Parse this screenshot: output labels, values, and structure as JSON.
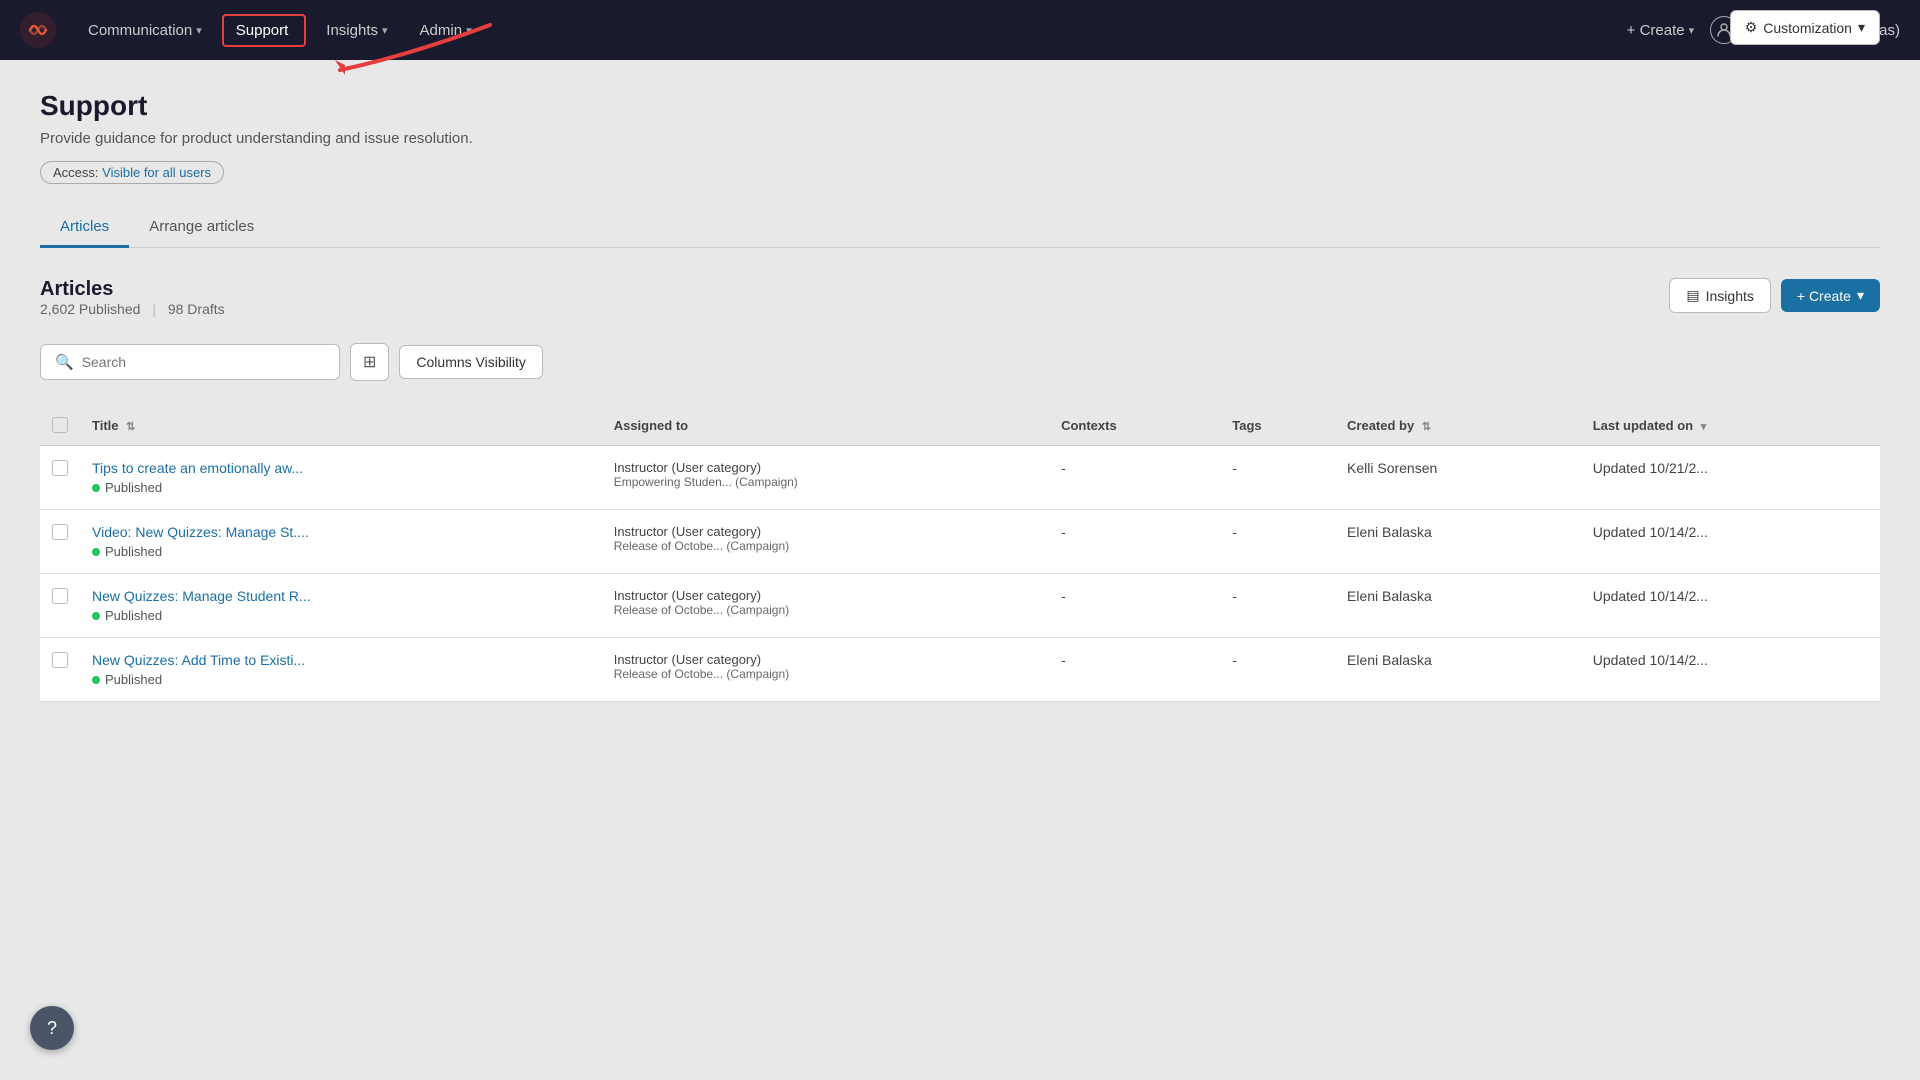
{
  "nav": {
    "logo": "✦",
    "items": [
      {
        "label": "Communication",
        "hasChevron": true,
        "active": false
      },
      {
        "label": "Support",
        "hasChevron": false,
        "active": true
      },
      {
        "label": "Insights",
        "hasChevron": true,
        "active": false
      },
      {
        "label": "Admin",
        "hasChevron": true,
        "active": false
      }
    ],
    "create_label": "+ Create",
    "workspace": "MASTER (precanvas)"
  },
  "page": {
    "title": "Support",
    "description": "Provide guidance for product understanding and issue resolution.",
    "access_label": "Access:",
    "access_value": "Visible for all users",
    "customization_label": "Customization"
  },
  "tabs": [
    {
      "label": "Articles",
      "active": true
    },
    {
      "label": "Arrange articles",
      "active": false
    }
  ],
  "articles": {
    "section_title": "Articles",
    "published_count": "2,602 Published",
    "drafts_count": "98 Drafts",
    "insights_btn": "Insights",
    "create_btn": "+ Create",
    "search_placeholder": "Search",
    "columns_visibility_label": "Columns Visibility",
    "columns": [
      {
        "label": "Title",
        "sortable": true
      },
      {
        "label": "Assigned to",
        "sortable": false
      },
      {
        "label": "Contexts",
        "sortable": false
      },
      {
        "label": "Tags",
        "sortable": false
      },
      {
        "label": "Created by",
        "sortable": true
      },
      {
        "label": "Last updated on",
        "sortable": true,
        "sort_dir": "desc"
      }
    ],
    "rows": [
      {
        "title": "Tips to create an emotionally aw...",
        "status": "Published",
        "assigned_primary": "Instructor (User category)",
        "assigned_secondary": "Empowering Studen... (Campaign)",
        "contexts": "-",
        "tags": "-",
        "created_by": "Kelli Sorensen",
        "last_updated": "Updated 10/21/2..."
      },
      {
        "title": "Video: New Quizzes: Manage St....",
        "status": "Published",
        "assigned_primary": "Instructor (User category)",
        "assigned_secondary": "Release of Octobe... (Campaign)",
        "contexts": "-",
        "tags": "-",
        "created_by": "Eleni Balaska",
        "last_updated": "Updated 10/14/2..."
      },
      {
        "title": "New Quizzes: Manage Student R...",
        "status": "Published",
        "assigned_primary": "Instructor (User category)",
        "assigned_secondary": "Release of Octobe... (Campaign)",
        "contexts": "-",
        "tags": "-",
        "created_by": "Eleni Balaska",
        "last_updated": "Updated 10/14/2..."
      },
      {
        "title": "New Quizzes: Add Time to Existi...",
        "status": "Published",
        "assigned_primary": "Instructor (User category)",
        "assigned_secondary": "Release of Octobe... (Campaign)",
        "contexts": "-",
        "tags": "-",
        "created_by": "Eleni Balaska",
        "last_updated": "Updated 10/14/2..."
      }
    ]
  },
  "help_btn": "?"
}
